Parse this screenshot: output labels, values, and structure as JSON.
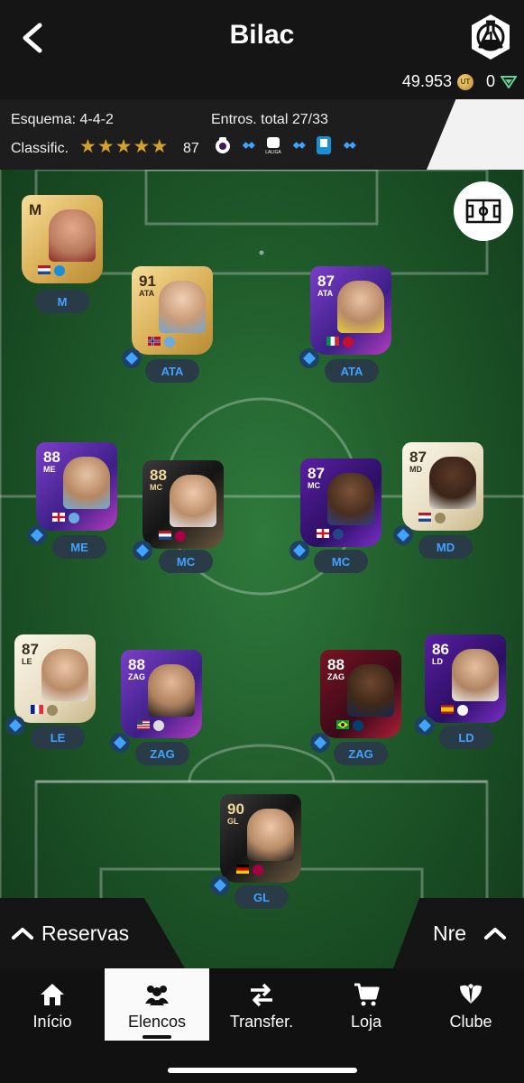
{
  "header": {
    "title": "Bilac",
    "coins": "49.953",
    "coin_icon_text": "UT",
    "points": "0"
  },
  "info": {
    "formation": "Esquema: 4-4-2",
    "rating_label": "Classific.",
    "rating_value": "87",
    "stars": 5,
    "chem_total": "Entros. total 27/33",
    "league_icons": [
      "premier-league-icon",
      "chem-diamond-icon",
      "laliga-icon",
      "chem-diamond-icon",
      "serie-a-icon",
      "chem-diamond-icon"
    ]
  },
  "players": [
    {
      "id": "manager",
      "rating": "M",
      "pos": "",
      "pill": "M",
      "style": "gold",
      "flags": [
        "nl"
      ],
      "badge": "serie-a"
    },
    {
      "id": "st-left",
      "rating": "91",
      "pos": "ATA",
      "pill": "ATA",
      "style": "gold",
      "flags": [
        "no"
      ],
      "badge": "man-city"
    },
    {
      "id": "st-right",
      "rating": "87",
      "pos": "ATA",
      "pill": "ATA",
      "style": "purple",
      "flags": [
        "it"
      ],
      "badge": "ac-milan"
    },
    {
      "id": "lm",
      "rating": "88",
      "pos": "ME",
      "pill": "ME",
      "style": "purple",
      "flags": [
        "en"
      ],
      "badge": "man-city"
    },
    {
      "id": "cm-left",
      "rating": "88",
      "pos": "MC",
      "pill": "MC",
      "style": "black",
      "flags": [
        "nl"
      ],
      "badge": "barcelona"
    },
    {
      "id": "cm-right",
      "rating": "87",
      "pos": "MC",
      "pill": "MC",
      "style": "darkpurple",
      "flags": [
        "en"
      ],
      "badge": "everton"
    },
    {
      "id": "rm",
      "rating": "87",
      "pos": "MD",
      "pill": "MD",
      "style": "icon-card",
      "flags": [
        "nl"
      ],
      "badge": "icon"
    },
    {
      "id": "lb",
      "rating": "87",
      "pos": "LE",
      "pill": "LE",
      "style": "icon-card",
      "flags": [
        "fr"
      ],
      "badge": "icon"
    },
    {
      "id": "cb-left",
      "rating": "88",
      "pos": "ZAG",
      "pill": "ZAG",
      "style": "purple",
      "flags": [
        "us"
      ],
      "badge": "nwsl"
    },
    {
      "id": "cb-right",
      "rating": "88",
      "pos": "ZAG",
      "pill": "ZAG",
      "style": "red",
      "flags": [
        "br"
      ],
      "badge": "psg"
    },
    {
      "id": "rb",
      "rating": "86",
      "pos": "LD",
      "pill": "LD",
      "style": "darkpurple",
      "flags": [
        "es"
      ],
      "badge": "real-madrid"
    },
    {
      "id": "gk",
      "rating": "90",
      "pos": "GL",
      "pill": "GL",
      "style": "black",
      "flags": [
        "de"
      ],
      "badge": "barcelona"
    }
  ],
  "reserves": {
    "left_label": "Reservas",
    "right_label": "Nre"
  },
  "nav": [
    {
      "label": "Início",
      "icon": "home-icon"
    },
    {
      "label": "Elencos",
      "icon": "squad-icon"
    },
    {
      "label": "Transfer.",
      "icon": "transfer-icon"
    },
    {
      "label": "Loja",
      "icon": "cart-icon"
    },
    {
      "label": "Clube",
      "icon": "club-icon"
    }
  ],
  "colors": {
    "accent_blue": "#3fa3ff",
    "star_gold": "#d4a22c",
    "pitch_green": "#2f7a3c"
  }
}
